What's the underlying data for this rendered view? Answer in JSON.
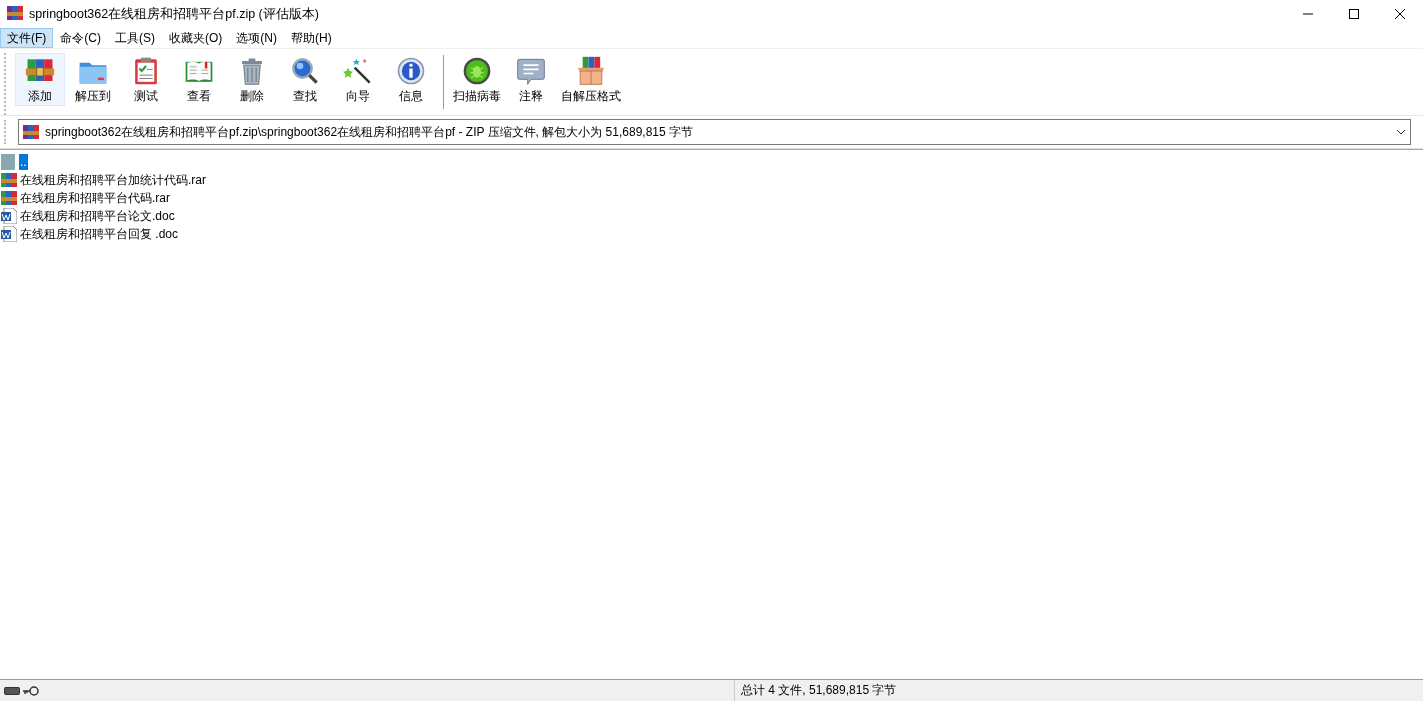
{
  "window": {
    "title": "springboot362在线租房和招聘平台pf.zip (评估版本)"
  },
  "menu": [
    {
      "label": "文件(F)",
      "selected": true
    },
    {
      "label": "命令(C)",
      "selected": false
    },
    {
      "label": "工具(S)",
      "selected": false
    },
    {
      "label": "收藏夹(O)",
      "selected": false
    },
    {
      "label": "选项(N)",
      "selected": false
    },
    {
      "label": "帮助(H)",
      "selected": false
    }
  ],
  "toolbar": [
    {
      "label": "添加",
      "kind": "add",
      "selected": true
    },
    {
      "label": "解压到",
      "kind": "extract",
      "selected": false
    },
    {
      "label": "测试",
      "kind": "test",
      "selected": false
    },
    {
      "label": "查看",
      "kind": "view",
      "selected": false
    },
    {
      "label": "删除",
      "kind": "delete",
      "selected": false
    },
    {
      "label": "查找",
      "kind": "find",
      "selected": false
    },
    {
      "label": "向导",
      "kind": "wizard",
      "selected": false
    },
    {
      "label": "信息",
      "kind": "info",
      "selected": false
    },
    {
      "label": "扫描病毒",
      "kind": "scan",
      "selected": false
    },
    {
      "label": "注释",
      "kind": "comment",
      "selected": false
    },
    {
      "label": "自解压格式",
      "kind": "sfx",
      "selected": false
    }
  ],
  "address": {
    "value": "springboot362在线租房和招聘平台pf.zip\\springboot362在线租房和招聘平台pf - ZIP 压缩文件, 解包大小为 51,689,815 字节"
  },
  "files": [
    {
      "name": "..",
      "kind": "parent",
      "selected": true
    },
    {
      "name": "在线租房和招聘平台加统计代码.rar",
      "kind": "archive",
      "selected": false
    },
    {
      "name": "在线租房和招聘平台代码.rar",
      "kind": "archive",
      "selected": false
    },
    {
      "name": "在线租房和招聘平台论文.doc",
      "kind": "document",
      "selected": false
    },
    {
      "name": "在线租房和招聘平台回复 .doc",
      "kind": "document",
      "selected": false
    }
  ],
  "status_bar": {
    "summary": "总计 4 文件, 51,689,815 字节"
  }
}
